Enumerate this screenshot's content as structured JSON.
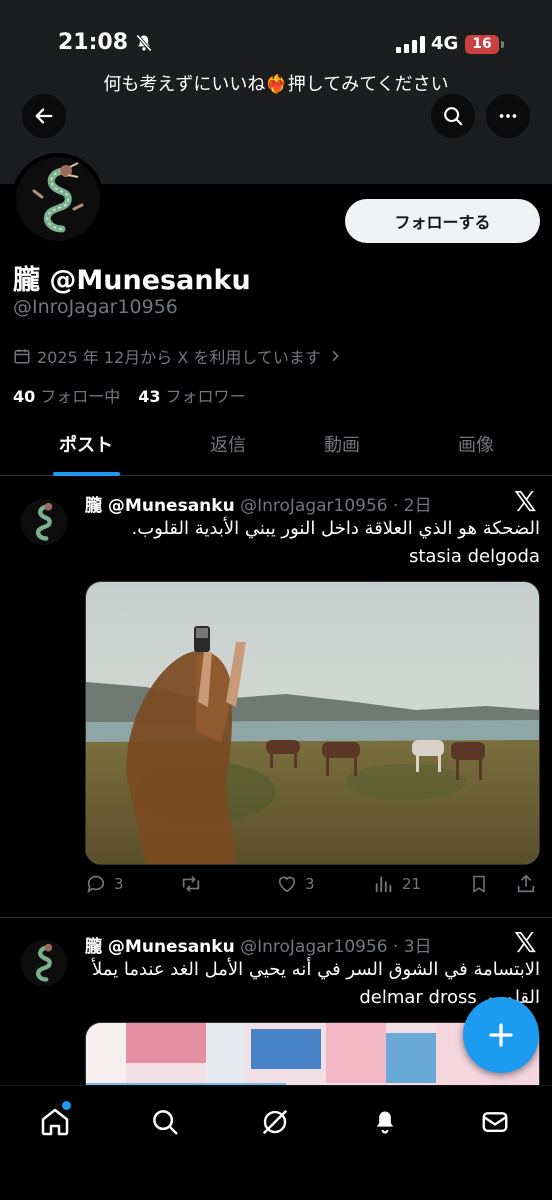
{
  "status": {
    "time": "21:08",
    "network": "4G",
    "battery": "16"
  },
  "header": {
    "title": "何も考えずにいいね❤️‍🔥押してみてください"
  },
  "profile": {
    "follow_label": "フォローする",
    "display_name": "朧 @Munesanku",
    "handle": "@InroJagar10956",
    "joined": "2025 年 12月から X を利用しています",
    "following_count": "40",
    "following_label": "フォロー中",
    "followers_count": "43",
    "followers_label": "フォロワー"
  },
  "tabs": [
    {
      "label": "ポスト"
    },
    {
      "label": "返信"
    },
    {
      "label": "動画"
    },
    {
      "label": "画像"
    }
  ],
  "posts": [
    {
      "name": "朧 @Munesanku",
      "meta": "@InroJagar10956 · 2日",
      "text_ar": "الضحكة هو الذي العلاقة داخل النور يبني الأبدية القلوب.",
      "text_en": "stasia delgoda",
      "replies": "3",
      "reposts": "",
      "likes": "3",
      "views": "21"
    },
    {
      "name": "朧 @Munesanku",
      "meta": "@InroJagar10956 · 3日",
      "text_ar": "الابتسامة في الشوق السر في أنه يحيي الأمل الغد عندما يملأ القلوب.",
      "text_en": "delmar dross"
    }
  ],
  "icons": {
    "back": "arrow-left-icon",
    "search": "search-icon",
    "more": "more-icon",
    "x_logo": "x-logo-icon",
    "fab": "plus-icon",
    "nav": [
      "home-icon",
      "search-icon",
      "grok-icon",
      "notifications-icon",
      "messages-icon"
    ]
  },
  "colors": {
    "accent": "#1d9bf0",
    "background": "#000000",
    "muted": "#71767b"
  }
}
